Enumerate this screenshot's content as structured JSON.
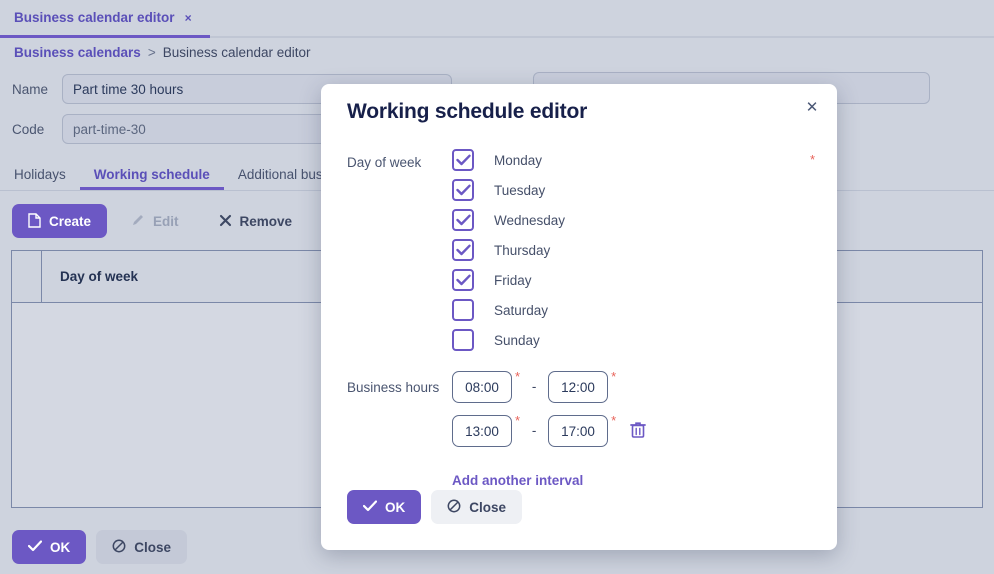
{
  "browser_tab": {
    "title": "Business calendar editor",
    "close_icon": "close-icon",
    "close_glyph": "×"
  },
  "breadcrumb": {
    "root": "Business calendars",
    "separator": ">",
    "current": "Business calendar editor"
  },
  "form": {
    "name_label": "Name",
    "name_value": "Part time 30 hours",
    "name_required": "*",
    "code_label": "Code",
    "code_value": "part-time-30"
  },
  "tabs": [
    {
      "label": "Holidays",
      "active": false
    },
    {
      "label": "Working schedule",
      "active": true
    },
    {
      "label": "Additional busine",
      "active": false
    }
  ],
  "toolbar": {
    "create_label": "Create",
    "create_icon": "file-icon",
    "edit_label": "Edit",
    "edit_icon": "pencil-icon",
    "remove_label": "Remove",
    "remove_icon": "cross-icon"
  },
  "grid": {
    "column_header": "Day of week",
    "rows": []
  },
  "page_footer": {
    "ok_label": "OK",
    "ok_icon": "check-icon",
    "close_label": "Close",
    "close_icon": "block-icon"
  },
  "modal": {
    "title": "Working schedule editor",
    "close_icon": "close-icon",
    "close_glyph": "✕",
    "day_of_week_label": "Day of week",
    "day_of_week_required": "*",
    "days": [
      {
        "label": "Monday",
        "checked": true
      },
      {
        "label": "Tuesday",
        "checked": true
      },
      {
        "label": "Wednesday",
        "checked": true
      },
      {
        "label": "Thursday",
        "checked": true
      },
      {
        "label": "Friday",
        "checked": true
      },
      {
        "label": "Saturday",
        "checked": false
      },
      {
        "label": "Sunday",
        "checked": false
      }
    ],
    "business_hours_label": "Business hours",
    "dash": "-",
    "intervals": [
      {
        "from": "08:00",
        "to": "12:00",
        "from_required": "*",
        "to_required": "*",
        "deletable": false
      },
      {
        "from": "13:00",
        "to": "17:00",
        "from_required": "*",
        "to_required": "*",
        "deletable": true,
        "delete_icon": "trash-icon"
      }
    ],
    "add_interval_label": "Add another interval",
    "ok_label": "OK",
    "ok_icon": "check-icon",
    "close_label": "Close",
    "close_button_icon": "block-icon"
  },
  "colors": {
    "accent": "#6c58c4",
    "page_bg": "#ced3de",
    "required": "#e8635a",
    "text": "#2b3a5c",
    "modal_bg": "#ffffff"
  }
}
